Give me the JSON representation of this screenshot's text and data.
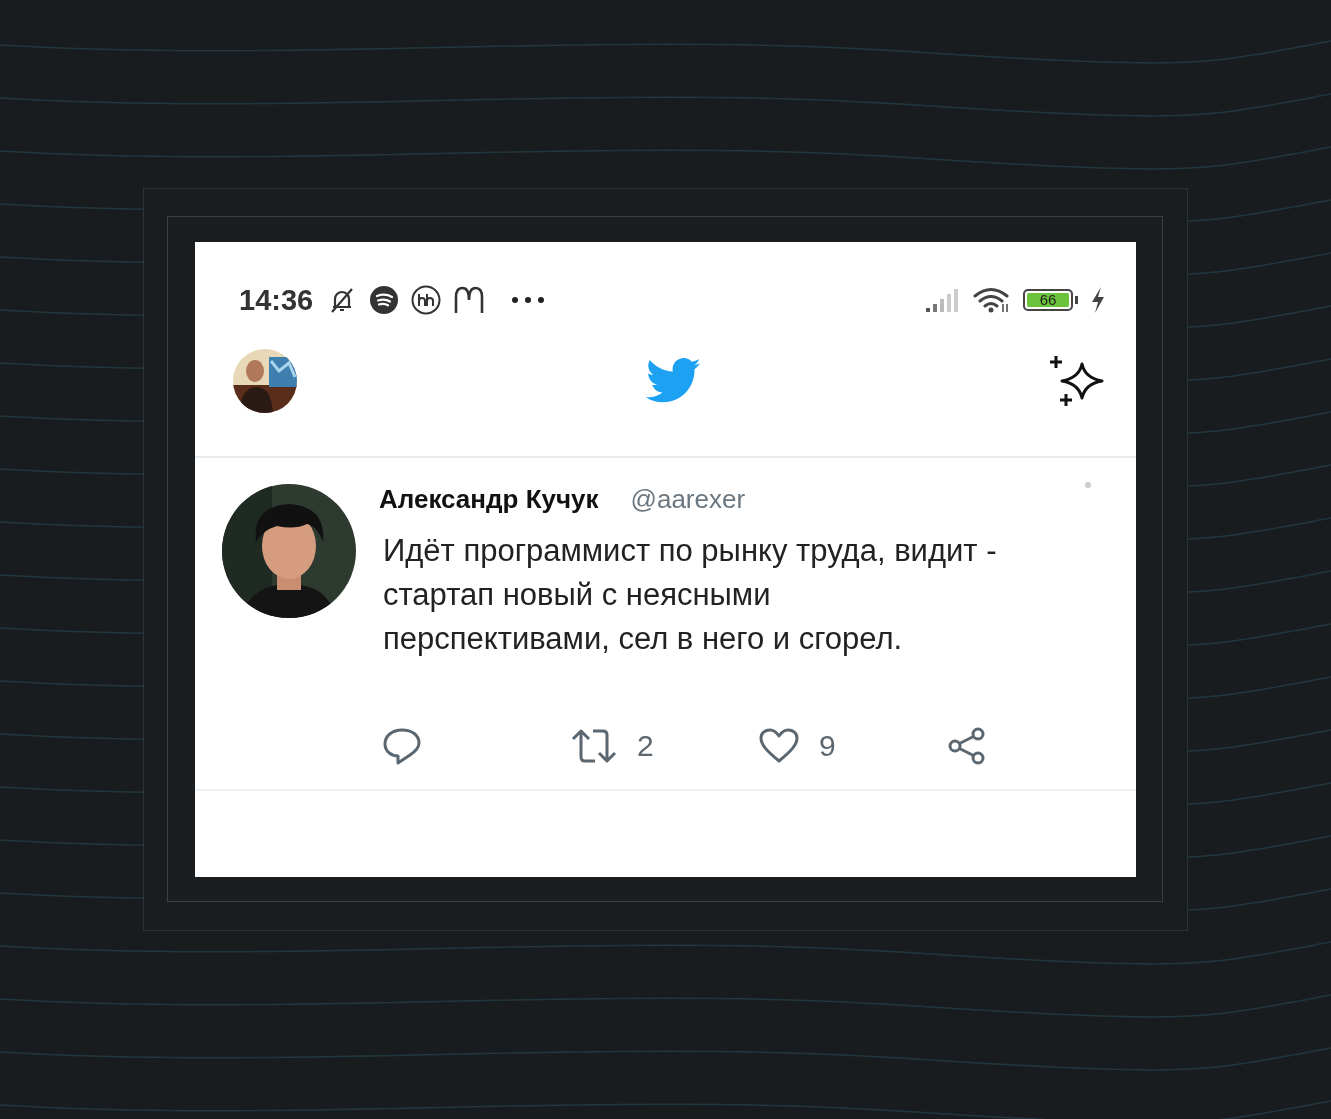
{
  "status_bar": {
    "time": "14:36",
    "battery": "66"
  },
  "tweet": {
    "author": "Александр Кучук",
    "handle": "@aarexer",
    "text": "Идёт программист по рынку труда, видит - стартап новый с неясными перспективами, сел в него и сгорел.",
    "actions": [
      {
        "kind": "reply"
      },
      {
        "kind": "retweet",
        "count": "2"
      },
      {
        "kind": "like",
        "count": "9"
      },
      {
        "kind": "share"
      }
    ]
  }
}
